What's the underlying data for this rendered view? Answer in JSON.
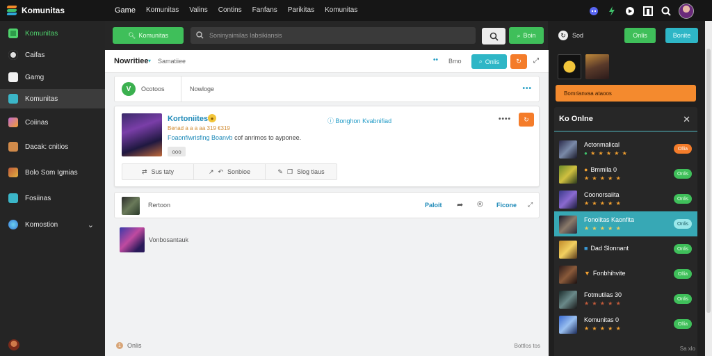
{
  "app": {
    "name": "Komunitas",
    "logo_colors": [
      "#f28a2a",
      "#3fc06a",
      "#2ea8d8"
    ]
  },
  "topnav": [
    "Game",
    "Komunitas",
    "Valins",
    "Contins",
    "Fanfans",
    "Parikitas",
    "Komunitas"
  ],
  "top_icons": [
    "discord-icon",
    "bolt-icon",
    "play-icon",
    "panel-icon",
    "search-icon",
    "user-avatar"
  ],
  "sidebar": {
    "items": [
      {
        "label": "Komunitas",
        "icon": "grid-icon",
        "color": "#4fd16c",
        "active": false,
        "green": true
      },
      {
        "label": "Caifas",
        "icon": "circle-icon",
        "color": "#e0e0e0"
      },
      {
        "label": "Gamg",
        "icon": "bag-icon",
        "color": "#f1f1f1"
      },
      {
        "label": "Komunitas",
        "icon": "map-icon",
        "color": "#3bb6c8",
        "active": true
      },
      {
        "label": "Coiinas",
        "icon": "game-icon",
        "color": "#c06ad0"
      },
      {
        "label": "Dacak: cnitios",
        "icon": "book-icon",
        "color": "#d08a4a"
      },
      {
        "label": "Bolo Som Igmias",
        "icon": "cards-icon",
        "color": "#c05a3a"
      },
      {
        "label": "Fosiinas",
        "icon": "chat-icon",
        "color": "#3bb6c8"
      },
      {
        "label": "Komostion",
        "icon": "globe-icon",
        "color": "#3a7ad8",
        "expandable": true
      }
    ]
  },
  "searchbar": {
    "left_button": "Komunitas",
    "placeholder": "Soninyaimilas Iabsikiansis",
    "right_button": "Boin"
  },
  "main": {
    "title": "Nowritiee",
    "subtitle": "Samatiiee",
    "header_link": "Bmo",
    "header_button": "Onlis",
    "tabs": [
      {
        "label": "Ocotoos",
        "badge": "V"
      },
      {
        "label": "Nowloge"
      }
    ],
    "post": {
      "name": "Kortoniitest",
      "meta": "Benad a a a aa 319 €319",
      "text_link": "Foaonfiwrisfing Boanvb",
      "text_rest": "cof anrimos to ayponee.",
      "tag": "ooo",
      "right_link": "Bonghon Kvabnifiad",
      "actions": [
        "Sus taty",
        "Sonbioe",
        "Slog tiaus"
      ]
    },
    "row2": {
      "label": "Rertoon",
      "link1": "Paloit",
      "link2": "Ficone"
    },
    "row3": {
      "label": "Vonbosantauk"
    },
    "footer": {
      "left": "Onlis",
      "left_num": "1",
      "right": "Bottlos tos"
    }
  },
  "rpanel": {
    "title": "Sod",
    "btn_green": "Onlis",
    "btn_teal": "Bonite",
    "orange_bar": "Bomrianvaa ataoos",
    "online_title": "Ko Onlne",
    "users": [
      {
        "name": "Actonmalical",
        "stars": "★ ★ ★ ★ ★",
        "btn": "Ollia",
        "btn_style": "orange"
      },
      {
        "name": "Bmmila 0",
        "stars": "★ ★ ★ ★ ★",
        "btn": "Onlis",
        "btn_style": "green"
      },
      {
        "name": "Coonorsaiita",
        "stars": "★ ★ ★ ★ ★",
        "btn": "Onlis",
        "btn_style": "green"
      },
      {
        "name": "Fonolitas Kaonfita",
        "stars": "★ ★ ★ ★ ★",
        "btn": "Onlis",
        "btn_style": "light",
        "selected": true
      },
      {
        "name": "Dad Slonnant",
        "stars": "",
        "btn": "Onlis",
        "btn_style": "green"
      },
      {
        "name": "Fonbhihvite",
        "stars": "",
        "btn": "Ollia",
        "btn_style": "green"
      },
      {
        "name": "Fotmutilas 30",
        "stars": "★ ★ ★ ★ ★",
        "btn": "Onlis",
        "btn_style": "green"
      },
      {
        "name": "Komunitas 0",
        "stars": "★ ★ ★ ★ ★",
        "btn": "Ollia",
        "btn_style": "green"
      }
    ],
    "footer": "Sa xlo"
  }
}
